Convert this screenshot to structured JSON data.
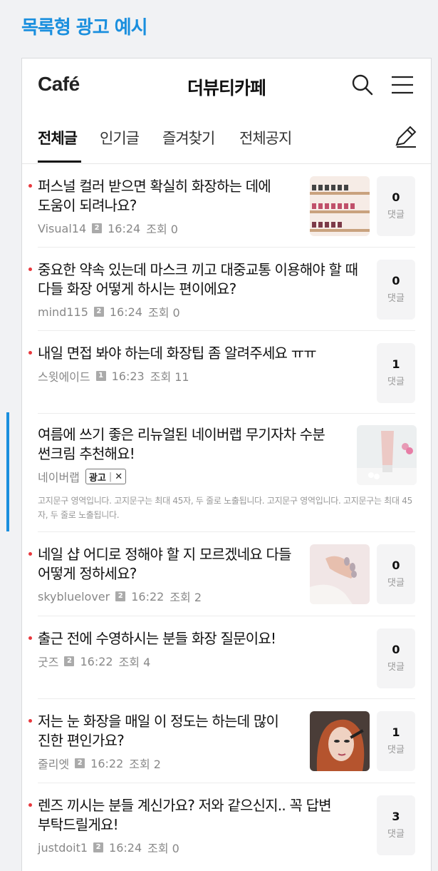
{
  "page_heading": "목록형 광고 예시",
  "header": {
    "logo": "Café",
    "cafe_name": "더뷰티카페"
  },
  "tabs": [
    {
      "label": "전체글",
      "active": true
    },
    {
      "label": "인기글",
      "active": false
    },
    {
      "label": "즐겨찾기",
      "active": false
    },
    {
      "label": "전체공지",
      "active": false
    }
  ],
  "posts": [
    {
      "title": "퍼스널 컬러 받으면 확실히 화장하는 데에 도움이 되려나요?",
      "author": "Visual14",
      "level": "2",
      "time": "16:24",
      "views": "조회 0",
      "comments": "0",
      "comment_label": "댓글"
    },
    {
      "title": "중요한 약속 있는데 마스크 끼고 대중교통 이용해야 할 때 다들 화장 어떻게 하시는 편이에요?",
      "author": "mind115",
      "level": "2",
      "time": "16:24",
      "views": "조회 0",
      "comments": "0",
      "comment_label": "댓글"
    },
    {
      "title": "내일 면접 봐야 하는데 화장팁 좀 알려주세요 ㅠㅠ",
      "author": "스윗에이드",
      "level": "1",
      "time": "16:23",
      "views": "조회 11",
      "comments": "1",
      "comment_label": "댓글"
    },
    {
      "title": "네일 샵 어디로 정해야 할 지 모르겠네요 다들 어떻게 정하세요?",
      "author": "skybluelover",
      "level": "2",
      "time": "16:22",
      "views": "조회 2",
      "comments": "0",
      "comment_label": "댓글"
    },
    {
      "title": "출근 전에 수영하시는 분들 화장 질문이요!",
      "author": "굿즈",
      "level": "2",
      "time": "16:22",
      "views": "조회 4",
      "comments": "0",
      "comment_label": "댓글"
    },
    {
      "title": "저는 눈 화장을 매일 이 정도는 하는데 많이 진한 편인가요?",
      "author": "줄리엣",
      "level": "2",
      "time": "16:22",
      "views": "조회 2",
      "comments": "1",
      "comment_label": "댓글"
    },
    {
      "title": "렌즈 끼시는 분들 계신가요? 저와 같으신지.. 꼭 답변 부탁드릴게요!",
      "author": "justdoit1",
      "level": "2",
      "time": "16:24",
      "views": "조회 0",
      "comments": "3",
      "comment_label": "댓글"
    }
  ],
  "ad": {
    "title": "여름에 쓰기 좋은 리뉴얼된 네이버랩 무기자차 수분 썬크림 추천해요!",
    "advertiser": "네이버랩",
    "tag_label": "광고",
    "tag_close": "✕",
    "description": "고지문구 영역입니다. 고지문구는 최대 45자, 두 줄로 노출됩니다. 고지문구 영역입니다. 고지문구는 최대 45자, 두 줄로 노출됩니다."
  },
  "colors": {
    "accent": "#1a8fde",
    "bullet": "#e8383d"
  }
}
